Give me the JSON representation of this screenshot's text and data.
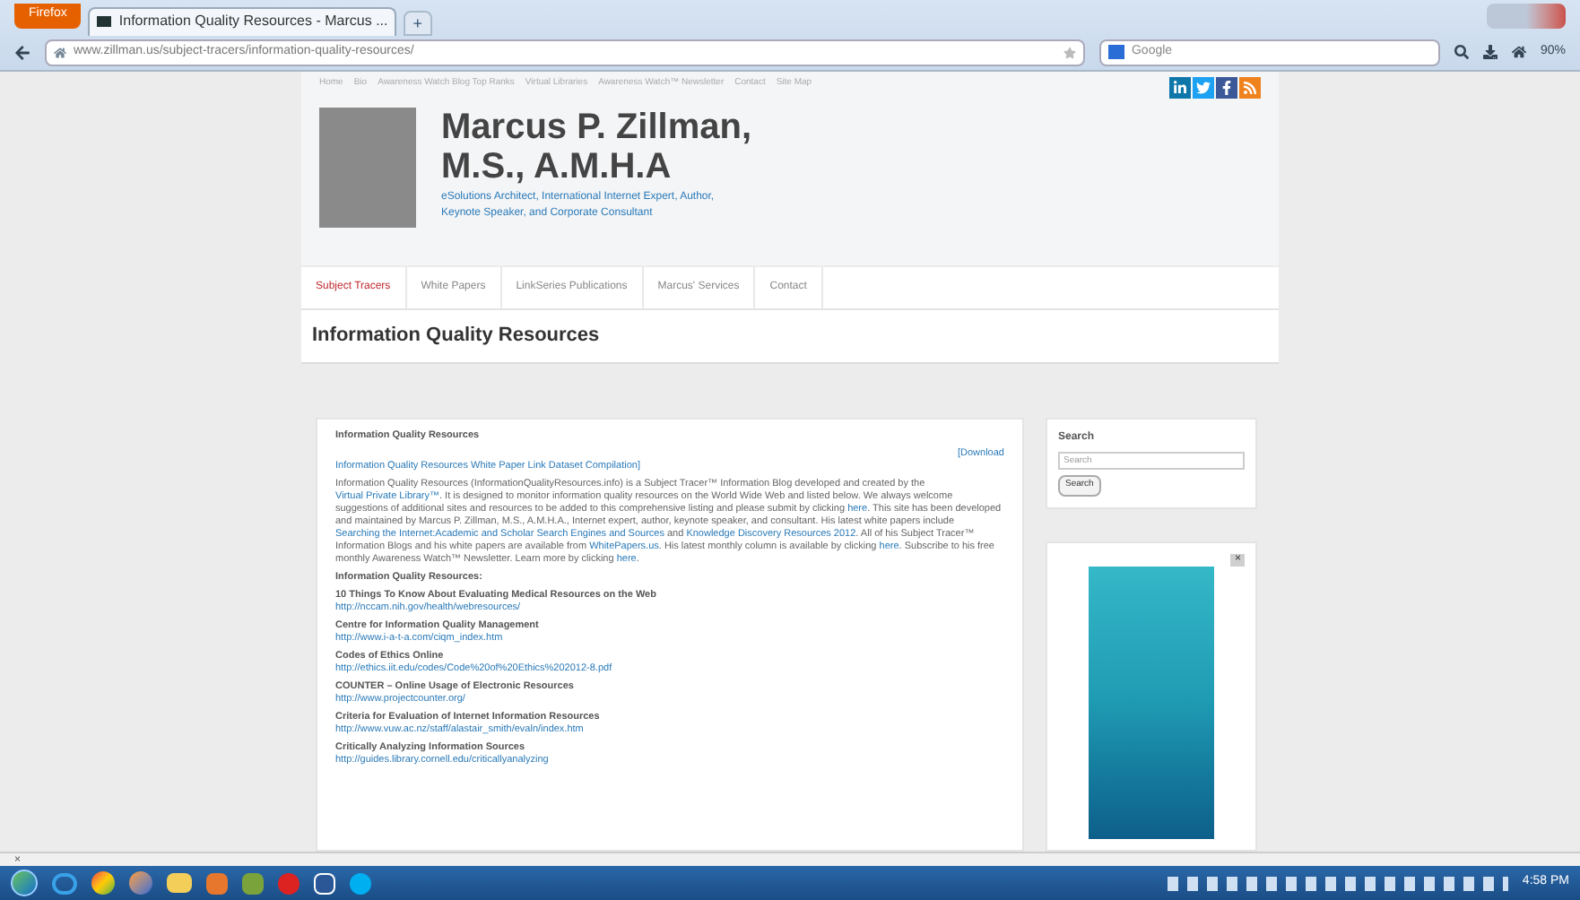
{
  "browser": {
    "menu_button": "Firefox",
    "tabs": [
      {
        "label": "Information Quality Resources - Marcus ...",
        "selected": true
      }
    ],
    "new_tab": "+",
    "url": "www.zillman.us/subject-tracers/information-quality-resources/",
    "search_engine": "Google",
    "zoom": "90%"
  },
  "top_links": [
    "Home",
    "Bio",
    "Awareness Watch Blog Top Ranks",
    "Virtual Libraries",
    "Awareness Watch™ Newsletter",
    "Contact",
    "Site Map"
  ],
  "header": {
    "name_line_1": "Marcus P. Zillman,",
    "name_line_2": "M.S., A.M.H.A",
    "tagline": "eSolutions Architect, International Internet Expert, Author, Keynote Speaker, and Corporate Consultant"
  },
  "nav": [
    {
      "label": "Subject Tracers",
      "selected": true
    },
    {
      "label": "White Papers",
      "selected": false
    },
    {
      "label": "LinkSeries Publications",
      "selected": false
    },
    {
      "label": "Marcus' Services",
      "selected": false
    },
    {
      "label": "Contact",
      "selected": false
    }
  ],
  "page_title": "Information Quality Resources",
  "post": {
    "heading": "Information Quality Resources",
    "download": "[Download",
    "link_title": "Information Quality Resources White Paper Link Dataset Compilation]",
    "intro": [
      {
        "kind": "text",
        "text": "Information Quality Resources (InformationQualityResources.info) is a Subject Tracer™ Information Blog developed and created by the "
      },
      {
        "kind": "link",
        "text": "Virtual Private Library™"
      },
      {
        "kind": "text",
        "text": ". It is designed to monitor information quality resources on the World Wide Web and listed below. We always welcome suggestions of additional sites and resources to be added to this comprehensive listing and please submit by clicking "
      },
      {
        "kind": "link",
        "text": "here"
      },
      {
        "kind": "text",
        "text": ". This site has been developed and maintained by Marcus P. Zillman, M.S., A.M.H.A., Internet expert, author, keynote speaker, and consultant. His latest white papers include "
      },
      {
        "kind": "link",
        "text": "Searching the Internet:"
      },
      {
        "kind": "link",
        "text": "Academic and Scholar Search Engines and Sources"
      },
      {
        "kind": "text",
        "text": " and "
      },
      {
        "kind": "link",
        "text": "Knowledge Discovery Resources 2012"
      },
      {
        "kind": "text",
        "text": ". All of his Subject Tracer™ Information Blogs and his white papers are available from "
      },
      {
        "kind": "link",
        "text": "WhitePapers.us"
      },
      {
        "kind": "text",
        "text": ". His latest monthly column is available by clicking "
      },
      {
        "kind": "link",
        "text": "here"
      },
      {
        "kind": "text",
        "text": ". Subscribe to his free monthly Awareness Watch™ Newsletter. Learn more by clicking "
      },
      {
        "kind": "link",
        "text": "here"
      },
      {
        "kind": "text",
        "text": "."
      }
    ],
    "list_heading": "Information Quality Resources:",
    "resources": [
      {
        "title": "10 Things To Know About Evaluating Medical Resources on the Web",
        "url": "http://nccam.nih.gov/health/webresources/"
      },
      {
        "title": "Centre for Information Quality Management",
        "url": "http://www.i-a-t-a.com/ciqm_index.htm"
      },
      {
        "title": "Codes of Ethics Online",
        "url": "http://ethics.iit.edu/codes/Code%20of%20Ethics%202012-8.pdf"
      },
      {
        "title": "COUNTER – Online Usage of Electronic Resources",
        "url": "http://www.projectcounter.org/"
      },
      {
        "title": "Criteria for Evaluation of Internet Information Resources",
        "url": "http://www.vuw.ac.nz/staff/alastair_smith/evaln/index.htm"
      },
      {
        "title": "Critically Analyzing Information Sources",
        "url": "http://guides.library.cornell.edu/criticallyanalyzing"
      }
    ]
  },
  "sidebar": {
    "search_heading": "Search",
    "search_placeholder": "Search",
    "search_button": "Search",
    "ad_close": "×"
  },
  "find_bar_close": "×",
  "taskbar": {
    "clock": "4:58 PM"
  }
}
